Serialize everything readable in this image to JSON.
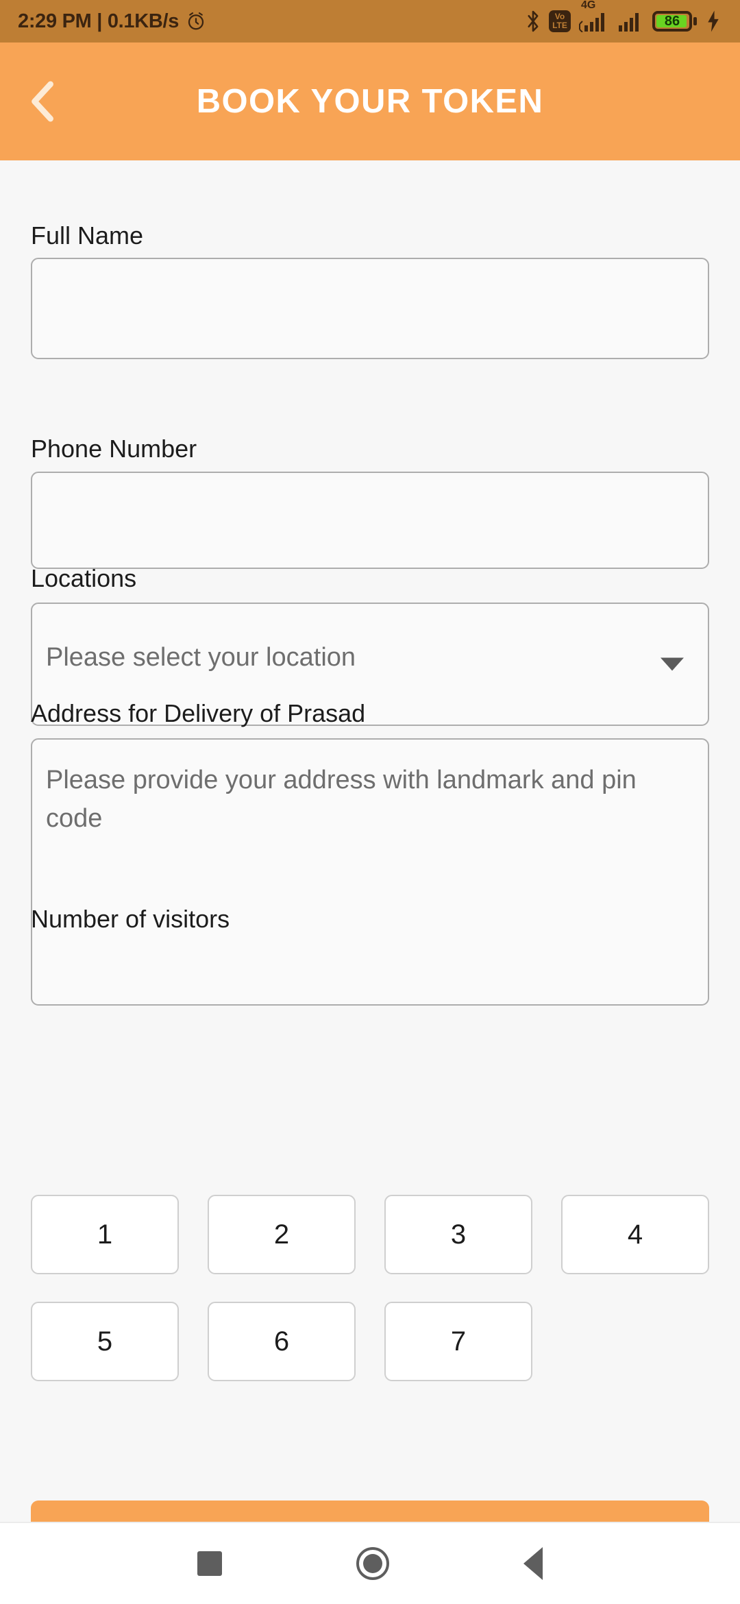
{
  "statusbar": {
    "clock": "2:29 PM | 0.1KB/s",
    "alarm_icon": "alarm-icon",
    "bluetooth_icon": "bluetooth-icon",
    "volte_top": "Vo",
    "volte_bottom": "LTE",
    "network_type": "4G",
    "battery_level": "86",
    "charging_icon": "charging-bolt-icon",
    "background": "#BE7E34",
    "foreground": "#3B2410",
    "battery_fill": "#69D421"
  },
  "appbar": {
    "title": "BOOK YOUR TOKEN",
    "back_icon": "back-chevron-icon",
    "background": "#F8A455",
    "title_color": "#FFFFFF"
  },
  "form": {
    "full_name": {
      "label": "Full Name",
      "value": "",
      "placeholder": ""
    },
    "phone_number": {
      "label": "Phone Number",
      "value": "",
      "placeholder": ""
    },
    "locations": {
      "label": "Locations",
      "selected": "Please select your location",
      "caret_icon": "chevron-down-icon"
    },
    "address": {
      "label": "Address for Delivery of Prasad",
      "value": "",
      "placeholder": "Please provide your address with landmark and pin code"
    },
    "visitors": {
      "label": "Number of visitors",
      "options": [
        "1",
        "2",
        "3",
        "4",
        "5",
        "6",
        "7"
      ],
      "selected": ""
    },
    "submit": {
      "label": "",
      "color": "#F8A455"
    }
  },
  "navbar": {
    "recent_icon": "recent-apps-icon",
    "home_icon": "home-icon",
    "back_icon": "back-triangle-icon",
    "color": "#5E5E5E"
  }
}
